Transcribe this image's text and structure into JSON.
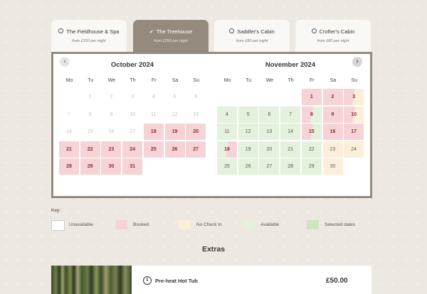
{
  "tabs": [
    {
      "title": "The Fieldhouse & Spa",
      "price": "from £250 per night",
      "active": false
    },
    {
      "title": "The Treehouse",
      "price": "from £250 per night",
      "active": true
    },
    {
      "title": "Saddler's Cabin",
      "price": "from £80 per night",
      "active": false
    },
    {
      "title": "Crofter's Cabin",
      "price": "from £80 per night",
      "active": false
    }
  ],
  "calendar": {
    "weekdays": [
      "Mo",
      "Tu",
      "We",
      "Th",
      "Fr",
      "Sa",
      "Su"
    ],
    "months": [
      {
        "title": "October 2024",
        "weeks": [
          [
            null,
            "1:u",
            "2:u",
            "3:u",
            "4:u",
            "5:u",
            "6:u"
          ],
          [
            "7:u",
            "8:u",
            "9:u",
            "10:u",
            "11:u",
            "12:u",
            "13:u"
          ],
          [
            "14:u",
            "15:u",
            "16:u",
            "17:u",
            "18:b",
            "19:b",
            "20:b"
          ],
          [
            "21:b",
            "22:b",
            "23:b",
            "24:b",
            "25:b",
            "26:b",
            "27:b"
          ],
          [
            "28:b",
            "29:b",
            "30:b",
            "31:b",
            null,
            null,
            null
          ]
        ]
      },
      {
        "title": "November 2024",
        "weeks": [
          [
            null,
            null,
            null,
            null,
            "1:b",
            "2:b",
            "3:bn"
          ],
          [
            "4:a",
            "5:a",
            "6:a",
            "7:a",
            "8:ab",
            "9:b",
            "10:bn"
          ],
          [
            "11:a",
            "12:a",
            "13:a",
            "14:a",
            "15:ab",
            "16:b",
            "17:b"
          ],
          [
            "18:ba",
            "19:a",
            "20:a",
            "21:a",
            "22:a",
            "23:n",
            "24:n"
          ],
          [
            "25:a",
            "26:a",
            "27:a",
            "28:a",
            "29:a",
            "30:n",
            null
          ]
        ]
      }
    ]
  },
  "key": {
    "title": "Key:",
    "items": [
      {
        "label": "Unavailable",
        "color": "#ffffff"
      },
      {
        "label": "Booked",
        "color": "#f6d3d6"
      },
      {
        "label": "No Check In",
        "color": "#fbefd9"
      },
      {
        "label": "Available",
        "color": "#e4f1dc"
      },
      {
        "label": "Selected dates",
        "color": "#cde5c0"
      }
    ]
  },
  "extras": {
    "heading": "Extras",
    "items": [
      {
        "title": "Pre-heat Hot Tub",
        "price": "£50.00",
        "icon": "info-icon"
      }
    ]
  },
  "nav": {
    "prev": "‹",
    "next": "›"
  }
}
